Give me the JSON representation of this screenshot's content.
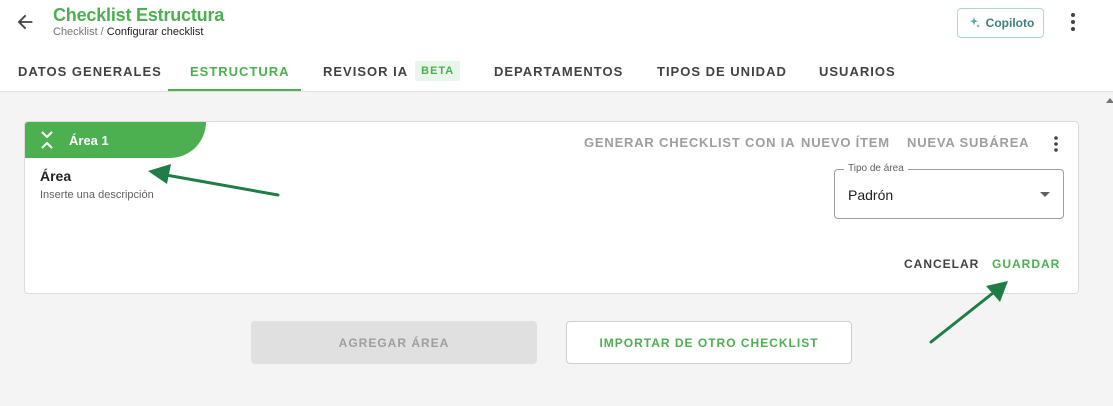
{
  "header": {
    "title": "Checklist Estructura",
    "breadcrumb_parent": "Checklist",
    "breadcrumb_separator": " / ",
    "breadcrumb_current": "Configurar checklist",
    "copilot_label": "Copiloto"
  },
  "tabs": [
    {
      "label": "DATOS GENERALES",
      "active": false
    },
    {
      "label": "ESTRUCTURA",
      "active": true
    },
    {
      "label": "REVISOR IA",
      "badge": "BETA",
      "active": false
    },
    {
      "label": "DEPARTAMENTOS",
      "active": false
    },
    {
      "label": "TIPOS DE UNIDAD",
      "active": false
    },
    {
      "label": "USUARIOS",
      "active": false
    }
  ],
  "area_card": {
    "chip_label": "Área 1",
    "actions": {
      "generate": "GENERAR CHECKLIST CON IA",
      "new_item": "NUEVO ÍTEM",
      "new_subarea": "NUEVA SUBÁREA"
    },
    "name": "Área",
    "description_placeholder": "Inserte una descripción",
    "area_type": {
      "legend": "Tipo de área",
      "value": "Padrón"
    },
    "cancel_label": "CANCELAR",
    "save_label": "GUARDAR"
  },
  "footer_buttons": {
    "add_area": "AGREGAR ÁREA",
    "import": "IMPORTAR DE OTRO CHECKLIST"
  },
  "colors": {
    "accent": "#4caf50",
    "annotation_arrow": "#1e7e46"
  }
}
